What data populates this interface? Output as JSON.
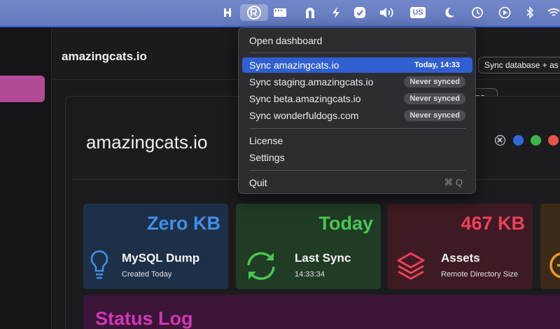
{
  "menubar": {
    "icons": [
      "h-app-icon",
      "syncing-app-icon",
      "window-list-icon",
      "magnet-icon",
      "lightning-icon",
      "task-check-icon",
      "volume-icon",
      "keyboard-layout-badge",
      "moon-icon",
      "time-machine-icon",
      "play-icon",
      "bluetooth-icon",
      "wifi-icon"
    ],
    "input_source": "US",
    "accent": "#6a7fc4"
  },
  "app": {
    "title": "amazingcats.io",
    "sync_database_button": "Sync database + as",
    "ps_button": "ps",
    "site_name": "amazingcats.io",
    "status_dots": [
      "#2f6bd8",
      "#3cb44b",
      "#e5534b"
    ],
    "cards": [
      {
        "value": "Zero KB",
        "label": "MySQL Dump",
        "sub": "Created Today",
        "icon": "lightbulb-icon",
        "bg": "#1e3048",
        "accent": "#3f8fe6"
      },
      {
        "value": "Today",
        "label": "Last Sync",
        "sub": "14:33:34",
        "icon": "refresh-icon",
        "bg": "#203c25",
        "accent": "#48c653"
      },
      {
        "value": "467 KB",
        "label": "Assets",
        "sub": "Remote Directory Size",
        "icon": "layers-icon",
        "bg": "#3e1b22",
        "accent": "#ef3f5b"
      },
      {
        "value": "",
        "label": "",
        "sub": "",
        "icon": "clock-icon",
        "bg": "#3a2a16",
        "accent": "#e89a2a"
      }
    ],
    "status_log_title": "Status Log"
  },
  "menu": {
    "open_dashboard": "Open dashboard",
    "sync_items": [
      {
        "label": "Sync amazingcats.io",
        "badge": "Today, 14:33",
        "highlighted": true
      },
      {
        "label": "Sync staging.amazingcats.io",
        "badge": "Never synced",
        "highlighted": false
      },
      {
        "label": "Sync beta.amazingcats.io",
        "badge": "Never synced",
        "highlighted": false
      },
      {
        "label": "Sync wonderfuldogs.com",
        "badge": "Never synced",
        "highlighted": false
      }
    ],
    "license": "License",
    "settings": "Settings",
    "quit": "Quit",
    "quit_shortcut": "⌘ Q",
    "highlight_color": "#2f5fd0"
  }
}
